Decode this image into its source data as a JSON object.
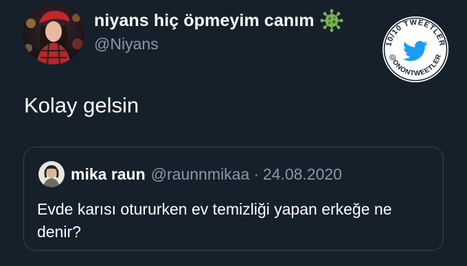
{
  "tweet": {
    "author": {
      "display_name": "niyans hiç öpmeyim canım",
      "handle": "@Niyans",
      "name_emoji": "virus-icon"
    },
    "text": "Kolay gelsin"
  },
  "quoted_tweet": {
    "author": {
      "display_name": "mika raun",
      "handle": "@raunnmikaa",
      "separator": "·",
      "date": "24.08.2020"
    },
    "text": "Evde karısı otururken ev temizliği yapan erkeğe ne denir?"
  },
  "watermark": {
    "top_text": "10/10 TWEETLER",
    "bottom_text": "@ONONTWEETLER",
    "icon": "twitter-bird-icon"
  },
  "colors": {
    "background": "#15202b",
    "primary_text": "#ffffff",
    "secondary_text": "#8b98a5",
    "card_border": "#38444d",
    "virus_green": "#77b255"
  }
}
